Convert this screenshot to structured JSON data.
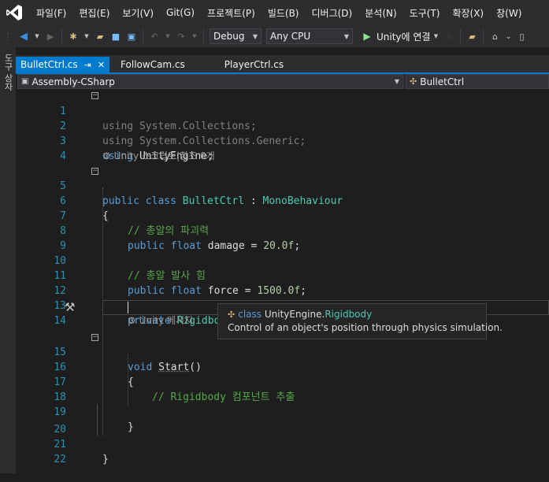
{
  "menu": {
    "items": [
      "파일(F)",
      "편집(E)",
      "보기(V)",
      "Git(G)",
      "프로젝트(P)",
      "빌드(B)",
      "디버그(D)",
      "분석(N)",
      "도구(T)",
      "확장(X)",
      "창(W)"
    ]
  },
  "toolbar": {
    "configuration": "Debug",
    "platform": "Any CPU",
    "run_label": "Unity에 연결"
  },
  "side_panel": {
    "label": "도구 상자"
  },
  "tabs": [
    {
      "label": "BulletCtrl.cs",
      "active": true
    },
    {
      "label": "FollowCam.cs",
      "active": false
    },
    {
      "label": "PlayerCtrl.cs",
      "active": false
    }
  ],
  "nav": {
    "project": "Assembly-CSharp",
    "class": "BulletCtrl"
  },
  "codelens": {
    "class_refs": "Unity 스크립트|참조 0개",
    "method_refs": "Unity 메시지"
  },
  "code_lines": [
    {
      "n": "1",
      "t": "using System.Collections;"
    },
    {
      "n": "2",
      "t": "using System.Collections.Generic;"
    },
    {
      "n": "3",
      "t": "using UnityEngine;"
    },
    {
      "n": "4",
      "t": ""
    },
    {
      "n": "5",
      "t": "public class BulletCtrl : MonoBehaviour"
    },
    {
      "n": "6",
      "t": "{"
    },
    {
      "n": "7",
      "t": "// 총알의 파괴력"
    },
    {
      "n": "8",
      "t": "public float damage = 20.0f;"
    },
    {
      "n": "9",
      "t": ""
    },
    {
      "n": "10",
      "t": "// 총알 발사 힘"
    },
    {
      "n": "11",
      "t": "public float force = 1500.0f;"
    },
    {
      "n": "12",
      "t": ""
    },
    {
      "n": "13",
      "t": "private Rigidbody rb;"
    },
    {
      "n": "14",
      "t": ""
    },
    {
      "n": "15",
      "t": "void Start()"
    },
    {
      "n": "16",
      "t": "{"
    },
    {
      "n": "17",
      "t": "// Rigidbody 컴포넌트 추출"
    },
    {
      "n": "18",
      "t": ""
    },
    {
      "n": "19",
      "t": "}"
    },
    {
      "n": "20",
      "t": ""
    },
    {
      "n": "21",
      "t": "}"
    },
    {
      "n": "22",
      "t": ""
    }
  ],
  "tooltip": {
    "kind": "class",
    "namespace": "UnityEngine.",
    "type": "Rigidbody",
    "description": "Control of an object's position through physics simulation."
  },
  "colors": {
    "accent": "#007acc",
    "keyword": "#569cd6",
    "type": "#4ec9b0",
    "comment": "#57a64a",
    "line_number": "#2b91af"
  }
}
